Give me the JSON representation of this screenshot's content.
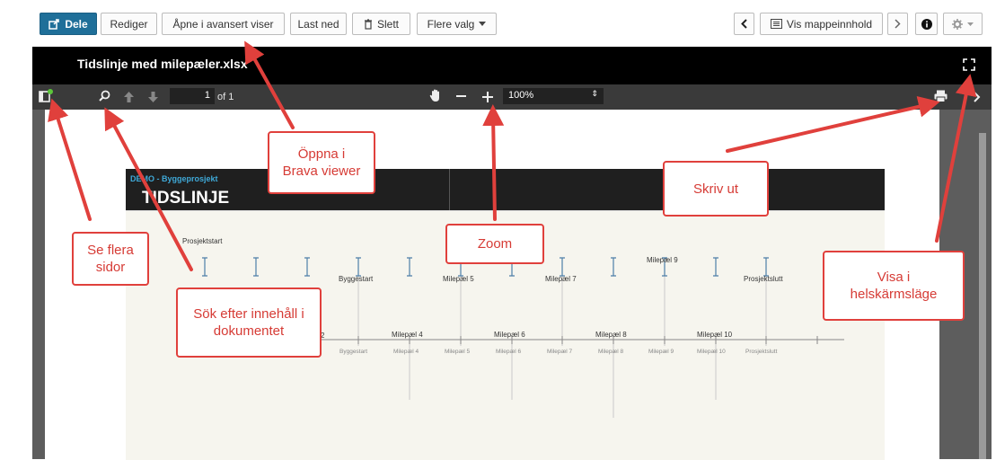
{
  "toolbar": {
    "share": "Dele",
    "edit": "Rediger",
    "open_advanced": "Åpne i avansert viser",
    "download": "Last ned",
    "delete": "Slett",
    "more": "Flere valg",
    "folder_content": "Vis mappeinnhold"
  },
  "viewer": {
    "document_name": "Tidslinje med milepæler.xlsx",
    "page_current": "1",
    "page_total": "of 1",
    "zoom": "100%"
  },
  "document": {
    "kicker": "DEMO - Byggeprosjekt",
    "title": "TIDSLINJE",
    "top_labels": [
      "Prosjektstart",
      "Byggestart",
      "Milepæl 5",
      "Milepæl 7",
      "Milepæl 9",
      "Prosjektslutt"
    ],
    "mid_labels": [
      "2",
      "Milepæl 4",
      "Milepæl 6",
      "Milepæl 8",
      "Milepæl 10"
    ],
    "axis_labels": [
      "Byggestart",
      "Milepæl 4",
      "Milepæl 5",
      "Milepæl 6",
      "Milepæl 7",
      "Milepæl 8",
      "Milepæl 9",
      "Milepæl 10",
      "Prosjektslutt"
    ]
  },
  "callouts": {
    "pages": "Se flera sidor",
    "search": "Sök efter innehåll i dokumentet",
    "brava": "Öppna i Brava viewer",
    "zoom": "Zoom",
    "print": "Skriv ut",
    "fullscreen": "Visa i helskärmsläge"
  },
  "colors": {
    "callout": "#e0403c",
    "primary": "#1f6f99"
  }
}
